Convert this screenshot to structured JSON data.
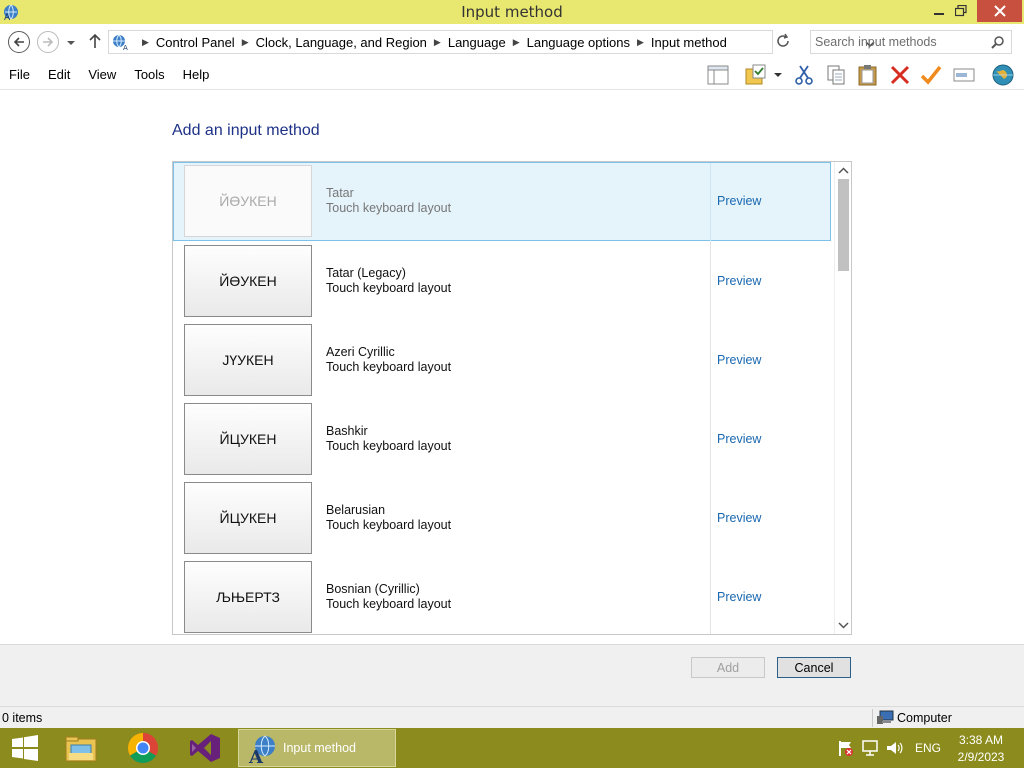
{
  "window": {
    "title": "Input method"
  },
  "address": {
    "crumbs": [
      "Control Panel",
      "Clock, Language, and Region",
      "Language",
      "Language options",
      "Input method"
    ]
  },
  "search": {
    "placeholder": "Search input methods"
  },
  "menu": {
    "file": "File",
    "edit": "Edit",
    "view": "View",
    "tools": "Tools",
    "help": "Help"
  },
  "content": {
    "heading": "Add an input method",
    "rows": [
      {
        "glyph": "ЙӨУКЕН",
        "name": "Tatar",
        "subtitle": "Touch keyboard layout",
        "link": "Preview",
        "selected": true
      },
      {
        "glyph": "ЙӨУКЕН",
        "name": "Tatar (Legacy)",
        "subtitle": "Touch keyboard layout",
        "link": "Preview"
      },
      {
        "glyph": "ЈҮУКЕН",
        "name": "Azeri Cyrillic",
        "subtitle": "Touch keyboard layout",
        "link": "Preview"
      },
      {
        "glyph": "ЙЦУКЕН",
        "name": "Bashkir",
        "subtitle": "Touch keyboard layout",
        "link": "Preview"
      },
      {
        "glyph": "ЙЦУКЕН",
        "name": "Belarusian",
        "subtitle": "Touch keyboard layout",
        "link": "Preview"
      },
      {
        "glyph": "ЉЊЕРТЗ",
        "name": "Bosnian (Cyrillic)",
        "subtitle": "Touch keyboard layout",
        "link": "Preview"
      }
    ]
  },
  "buttons": {
    "add": "Add",
    "cancel": "Cancel"
  },
  "status": {
    "items": "0 items",
    "location": "Computer"
  },
  "taskbar": {
    "active_label": "Input method",
    "lang": "ENG",
    "time": "3:38 AM",
    "date": "2/9/2023"
  },
  "colors": {
    "titlebar": "#e8e770",
    "taskbar": "#8c8c1e",
    "heading": "#1e3287",
    "link": "#1a68b0",
    "selection": "#e5f3fb"
  }
}
